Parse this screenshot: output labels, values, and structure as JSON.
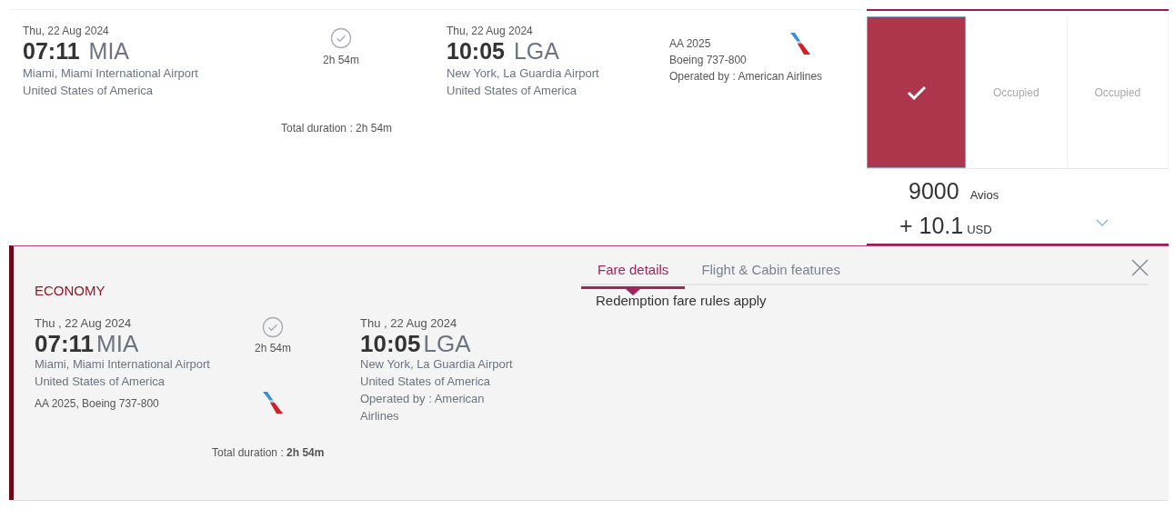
{
  "flight": {
    "departure": {
      "date": "Thu, 22 Aug 2024",
      "time": "07:11",
      "code": "MIA",
      "airport": "Miami, Miami International Airport",
      "country": "United States of America"
    },
    "duration": "2h 54m",
    "arrival": {
      "date": "Thu, 22 Aug 2024",
      "time": "10:05",
      "code": "LGA",
      "airport": "New York, La Guardia Airport",
      "country": "United States of America"
    },
    "flight_number": "AA 2025",
    "aircraft": "Boeing 737-800",
    "operated_by": "Operated by : American Airlines",
    "total_duration": "Total duration : 2h 54m"
  },
  "fares": [
    {
      "selected": true
    },
    {
      "selected": false,
      "label": "Occupied"
    },
    {
      "selected": false,
      "label": "Occupied"
    }
  ],
  "price": {
    "amount": "9000",
    "unit": "Avios",
    "tax": "+ 10.1",
    "currency": "USD",
    "expanded": true
  },
  "details": {
    "cabin": "ECONOMY",
    "departure": {
      "date": "Thu , 22 Aug 2024",
      "time": "07:11",
      "code": "MIA",
      "airport": "Miami, Miami International Airport",
      "country": "United States of America"
    },
    "duration": "2h 54m",
    "flight_info": "AA 2025, Boeing 737-800",
    "arrival": {
      "date": "Thu , 22 Aug 2024",
      "time": "10:05",
      "code": "LGA",
      "airport": "New York, La Guardia Airport",
      "country": "United States of America"
    },
    "operated_by": "Operated by : American Airlines",
    "total_duration": "Total duration : **2h 54m**",
    "tabs": [
      {
        "label": "Fare details",
        "selected": true
      },
      {
        "label": "Flight & Cabin features",
        "selected": false
      }
    ],
    "fare_note": "Redemption fare rules apply"
  }
}
